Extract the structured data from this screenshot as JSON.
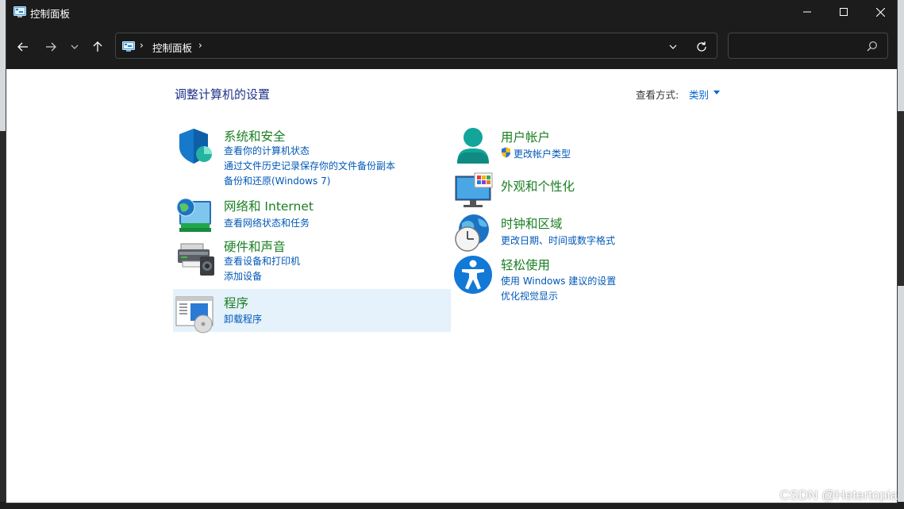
{
  "window": {
    "title": "控制面板"
  },
  "address_bar": {
    "location": "控制面板",
    "separator": "›"
  },
  "search": {
    "placeholder": ""
  },
  "main": {
    "heading": "调整计算机的设置",
    "view_by_label": "查看方式:",
    "view_by_value": "类别"
  },
  "categories": {
    "system": {
      "title": "系统和安全",
      "links": [
        "查看你的计算机状态",
        "通过文件历史记录保存你的文件备份副本",
        "备份和还原(Windows 7)"
      ]
    },
    "network": {
      "title": "网络和 Internet",
      "links": [
        "查看网络状态和任务"
      ]
    },
    "hardware": {
      "title": "硬件和声音",
      "links": [
        "查看设备和打印机",
        "添加设备"
      ]
    },
    "programs": {
      "title": "程序",
      "links": [
        "卸载程序"
      ]
    },
    "accounts": {
      "title": "用户帐户",
      "links": [
        "更改帐户类型"
      ]
    },
    "appearance": {
      "title": "外观和个性化",
      "links": []
    },
    "clock": {
      "title": "时钟和区域",
      "links": [
        "更改日期、时间或数字格式"
      ]
    },
    "ease": {
      "title": "轻松使用",
      "links": [
        "使用 Windows 建议的设置",
        "优化视觉显示"
      ]
    }
  },
  "watermark": "CSDN @Hetertopia",
  "colors": {
    "title_green": "#1a7f23",
    "link_blue": "#0058b8",
    "heading_blue": "#1e3287",
    "titlebar": "#1c1c1c",
    "hover": "#e5f1fb"
  }
}
